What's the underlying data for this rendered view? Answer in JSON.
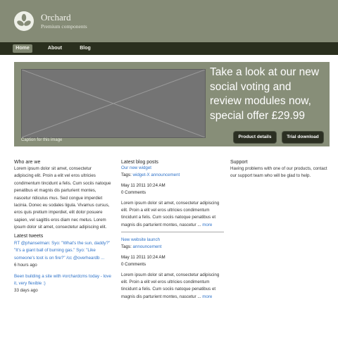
{
  "brand": {
    "name": "Orchard",
    "tagline": "Premium components",
    "logo_icon": "leaf-logo-icon"
  },
  "nav": {
    "items": [
      {
        "label": "Home",
        "active": true
      },
      {
        "label": "About"
      },
      {
        "label": "Blog"
      }
    ]
  },
  "hero": {
    "headline_lines": [
      "Take a look at our new",
      "social voting and",
      "review modules now,",
      "special offer £29.99"
    ],
    "caption": "Caption for this image",
    "buttons": {
      "details": "Product details",
      "trial": "Trial download"
    }
  },
  "who": {
    "title": "Who are we",
    "lines": [
      "Lorem ipsum dolor sit amet, consectetur",
      "adipiscing elit. Proin a elit vel eros ultricies",
      "condimentum tincidunt a felis. Cum sociis natoque",
      "penatibus et magnis dis parturient montes,",
      "nascetur ridiculus mus. Sed congue imperdiet",
      "lacinia. Donec eu sodales ligula. Vivamus cursus,",
      "eros quis pretium imperdiet, elit dolor posuere",
      "sapien, vel sagittis eros diam nec metus. Lorem",
      "ipsum dolor sit amet, consectetur adipiscing elit."
    ]
  },
  "tweets": {
    "title": "Latest tweets",
    "items": [
      {
        "lines": [
          "RT @phanselman: Syo: \"What's the sun, daddy?\"",
          "\"It's a giant ball of burning gas.\" Syo: \"Like",
          "someone's toot is on fire?\" /cc @overheardb ..."
        ],
        "time": "6 hours ago"
      },
      {
        "lines": [
          "Been building a site with #orchardcms today - love",
          "it, very flexible :)"
        ],
        "time": "33 days ago"
      }
    ]
  },
  "blog": {
    "title": "Latest blog posts",
    "posts": [
      {
        "title": "Our new widget",
        "tags_label": "Tags:",
        "tags": "widget-X announcement",
        "date": "May 11 2011 10:24 AM",
        "comments": "0 Comments",
        "lines": [
          "Lorem ipsum dolor sit amet, consectetur adipiscing",
          "elit. Proin a elit vel eros ultricies condimentum",
          "tincidunt a felis. Cum sociis natoque penatibus et",
          "magnis dis parturient montes, nascetur ..."
        ],
        "more": "more"
      },
      {
        "title": "New website launch",
        "tags_label": "Tags:",
        "tags": "announcement",
        "date": "May 11 2011 10:24 AM",
        "comments": "0 Comments",
        "lines": [
          "Lorem ipsum dolor sit amet, consectetur adipiscing",
          "elit. Proin a elit vel eros ultricies condimentum",
          "tincidunt a felis. Cum sociis natoque penatibus et",
          "magnis dis parturient montes, nascetur ..."
        ],
        "more": "more"
      }
    ]
  },
  "support": {
    "title": "Support",
    "lines": [
      "Having problems with one of our products, contact",
      "our support team who will be glad to help."
    ]
  },
  "colors": {
    "header": "#858b76",
    "nav": "#2a2f1e",
    "hero": "#878e78",
    "link": "#2f73c9"
  }
}
